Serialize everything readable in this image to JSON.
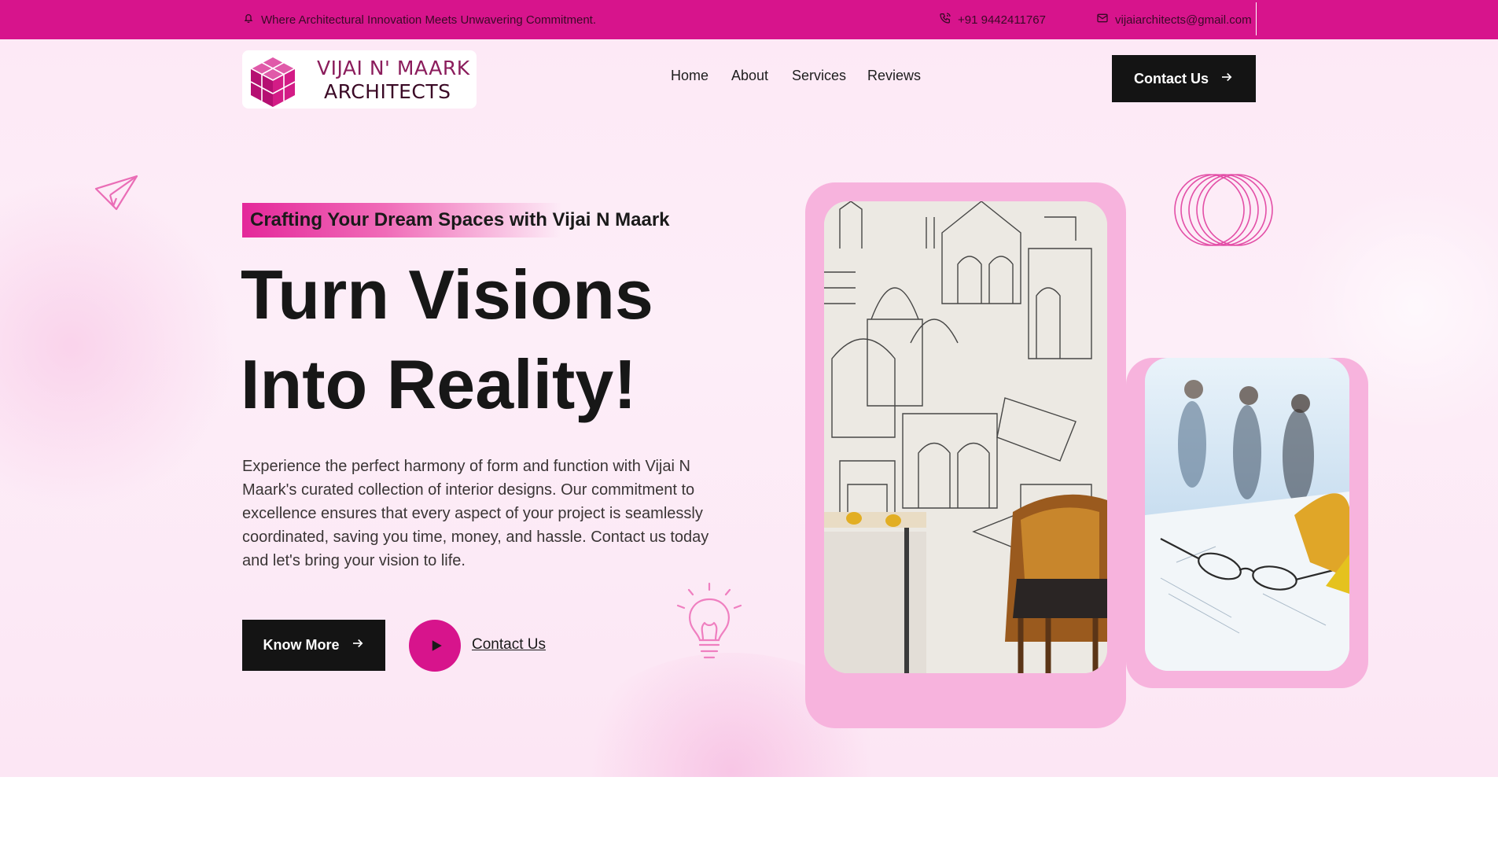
{
  "topbar": {
    "announcement": "Where Architectural Innovation Meets Unwavering Commitment.",
    "phone": "+91 9442411767",
    "email": "vijaiarchitects@gmail.com",
    "background_color": "#d7148c"
  },
  "header": {
    "logo_line1": "VIJAI N' MAARK",
    "logo_line2": "ARCHITECTS",
    "nav": [
      "Home",
      "About",
      "Services",
      "Reviews"
    ],
    "cta_label": "Contact Us"
  },
  "hero": {
    "tagline": "Crafting Your Dream Spaces with Vijai N Maark",
    "headline_line1": "Turn Visions",
    "headline_line2": "Into Reality!",
    "description": "Experience the perfect harmony of form and function with Vijai N Maark's curated collection of interior designs. Our commitment to excellence ensures that every aspect of your project is seamlessly coordinated, saving you time, money, and hassle. Contact us today and let's bring your vision to life.",
    "primary_button": "Know More",
    "secondary_link": "Contact Us",
    "accent_color": "#d7148c"
  },
  "icons": {
    "bell": "bell-icon",
    "phone": "phone-icon",
    "mail": "mail-icon",
    "arrow": "arrow-right-icon",
    "play": "play-icon",
    "paper_plane": "paper-plane-icon",
    "lightbulb": "lightbulb-icon",
    "rings": "rings-decoration-icon"
  }
}
